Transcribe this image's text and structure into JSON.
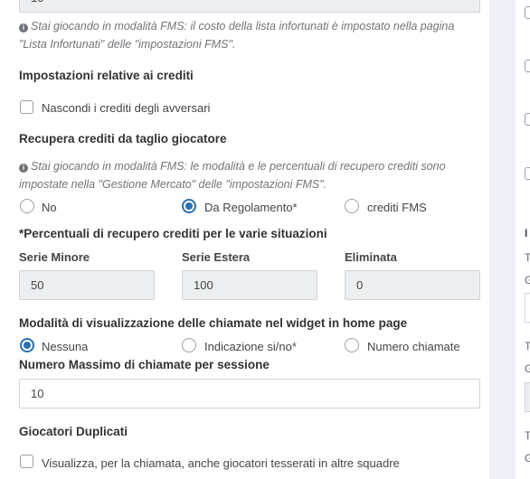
{
  "top_input": {
    "value": "10"
  },
  "fms_notice_1": "Stai giocando in modalità FMS: il costo della lista infortunati è impostato nella pagina \"Lista Infortunati\" delle \"impostazioni FMS\".",
  "credits_section": {
    "title": "Impostazioni relative ai crediti",
    "hide_opponents_credits_label": "Nascondi i crediti degli avversari"
  },
  "recover_credits": {
    "title": "Recupera crediti da taglio giocatore",
    "notice": "Stai giocando in modalità FMS: le modalità e le percentuali di recupero crediti sono impostate nella \"Gestione Mercato\" delle \"impostazioni FMS\".",
    "options": [
      "No",
      "Da Regolamento*",
      "crediti FMS"
    ],
    "selected": "Da Regolamento*"
  },
  "percentages": {
    "title": "*Percentuali di recupero crediti per le varie situazioni",
    "fields": [
      {
        "label": "Serie Minore",
        "value": "50"
      },
      {
        "label": "Serie Estera",
        "value": "100"
      },
      {
        "label": "Eliminata",
        "value": "0"
      }
    ]
  },
  "calls_widget": {
    "title": "Modalità di visualizzazione delle chiamate nel widget in home page",
    "options": [
      "Nessuna",
      "Indicazione si/no*",
      "Numero chiamate"
    ],
    "selected": "Nessuna"
  },
  "max_calls": {
    "title": "Numero Massimo di chiamate per sessione",
    "value": "10"
  },
  "duplicate_players": {
    "title": "Giocatori Duplicati",
    "checkbox_label": "Visualizza, per la chiamata, anche giocatori tesserati in altre squadre"
  },
  "right_panel": {
    "letters": [
      "I",
      "T",
      "G",
      "T",
      "G",
      "T",
      "G"
    ]
  },
  "icons": {
    "info": "info-circle-icon"
  },
  "colors": {
    "accent": "#2a6fb0",
    "background": "#eef0f5",
    "disabled_input": "#eceef0"
  }
}
